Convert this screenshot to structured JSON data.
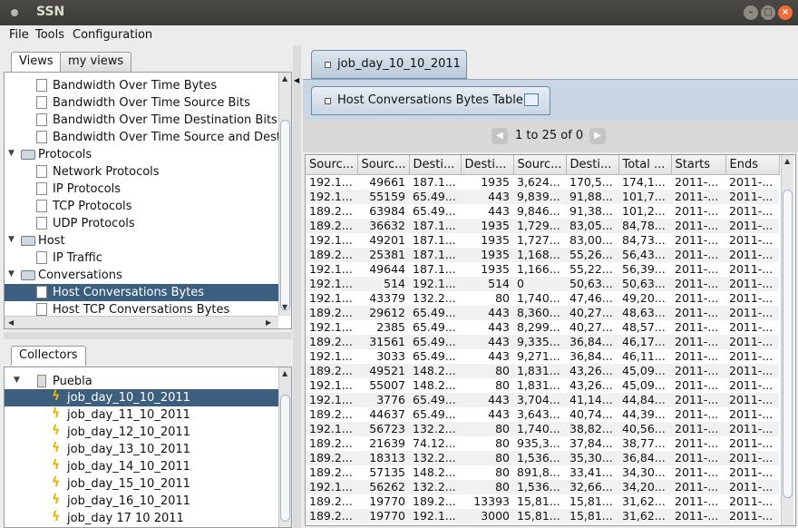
{
  "window": {
    "title": "SSN"
  },
  "menu": [
    "File",
    "Tools",
    "Configuration"
  ],
  "views_panel": {
    "tabs": [
      "Views",
      "my views"
    ],
    "items": [
      {
        "label": "Bandwidth Over Time Bytes",
        "type": "doc",
        "level": 2
      },
      {
        "label": "Bandwidth Over Time Source Bits",
        "type": "doc",
        "level": 2
      },
      {
        "label": "Bandwidth Over Time Destination Bits",
        "type": "doc",
        "level": 2
      },
      {
        "label": "Bandwidth Over Time Source and Destin",
        "type": "doc",
        "level": 2
      },
      {
        "label": "Protocols",
        "type": "folder",
        "level": 1
      },
      {
        "label": "Network Protocols",
        "type": "doc",
        "level": 2
      },
      {
        "label": "IP Protocols",
        "type": "doc",
        "level": 2
      },
      {
        "label": "TCP Protocols",
        "type": "doc",
        "level": 2
      },
      {
        "label": "UDP Protocols",
        "type": "doc",
        "level": 2
      },
      {
        "label": "Host",
        "type": "folder",
        "level": 1
      },
      {
        "label": "IP Traffic",
        "type": "doc",
        "level": 2
      },
      {
        "label": "Conversations",
        "type": "folder",
        "level": 1
      },
      {
        "label": "Host Conversations Bytes",
        "type": "doc",
        "level": 2,
        "selected": true
      },
      {
        "label": "Host TCP Conversations Bytes",
        "type": "doc",
        "level": 2
      }
    ]
  },
  "collectors_panel": {
    "tab": "Collectors",
    "root": "Puebla",
    "jobs": [
      {
        "label": "job_day_10_10_2011",
        "selected": true
      },
      {
        "label": "job_day_11_10_2011"
      },
      {
        "label": "job_day_12_10_2011"
      },
      {
        "label": "job_day_13_10_2011"
      },
      {
        "label": "job_day_14_10_2011"
      },
      {
        "label": "job_day_15_10_2011"
      },
      {
        "label": "job_day_16_10_2011"
      },
      {
        "label": "job_day 17 10 2011"
      }
    ]
  },
  "right": {
    "job_tab": "job_day_10_10_2011",
    "view_tab": "Host Conversations Bytes Table",
    "pager_text": "1 to 25 of 0",
    "columns": [
      "Sourc...",
      "Sourc...",
      "Desti...",
      "Desti...",
      "Sourc...",
      "Desti...",
      "Total ...",
      "Starts",
      "Ends"
    ],
    "rows": [
      [
        "192.1...",
        "49661",
        "187.1...",
        "1935",
        "3,624...",
        "170,5...",
        "174,1...",
        "2011-...",
        "2011-..."
      ],
      [
        "192.1...",
        "55159",
        "65.49...",
        "443",
        "9,839...",
        "91,88...",
        "101,7...",
        "2011-...",
        "2011-..."
      ],
      [
        "189.2...",
        "63984",
        "65.49...",
        "443",
        "9,846...",
        "91,38...",
        "101,2...",
        "2011-...",
        "2011-..."
      ],
      [
        "189.2...",
        "36632",
        "187.1...",
        "1935",
        "1,729...",
        "83,05...",
        "84,78...",
        "2011-...",
        "2011-..."
      ],
      [
        "192.1...",
        "49201",
        "187.1...",
        "1935",
        "1,727...",
        "83,00...",
        "84,73...",
        "2011-...",
        "2011-..."
      ],
      [
        "189.2...",
        "25381",
        "187.1...",
        "1935",
        "1,168...",
        "55,26...",
        "56,43...",
        "2011-...",
        "2011-..."
      ],
      [
        "192.1...",
        "49644",
        "187.1...",
        "1935",
        "1,166...",
        "55,22...",
        "56,39...",
        "2011-...",
        "2011-..."
      ],
      [
        "192.1...",
        "514",
        "192.1...",
        "514",
        "0",
        "50,63...",
        "50,63...",
        "2011-...",
        "2011-..."
      ],
      [
        "192.1...",
        "43379",
        "132.2...",
        "80",
        "1,740...",
        "47,46...",
        "49,20...",
        "2011-...",
        "2011-..."
      ],
      [
        "189.2...",
        "29612",
        "65.49...",
        "443",
        "8,360...",
        "40,27...",
        "48,63...",
        "2011-...",
        "2011-..."
      ],
      [
        "192.1...",
        "2385",
        "65.49...",
        "443",
        "8,299...",
        "40,27...",
        "48,57...",
        "2011-...",
        "2011-..."
      ],
      [
        "189.2...",
        "31561",
        "65.49...",
        "443",
        "9,335...",
        "36,84...",
        "46,17...",
        "2011-...",
        "2011-..."
      ],
      [
        "192.1...",
        "3033",
        "65.49...",
        "443",
        "9,271...",
        "36,84...",
        "46,11...",
        "2011-...",
        "2011-..."
      ],
      [
        "189.2...",
        "49521",
        "148.2...",
        "80",
        "1,831...",
        "43,26...",
        "45,09...",
        "2011-...",
        "2011-..."
      ],
      [
        "192.1...",
        "55007",
        "148.2...",
        "80",
        "1,831...",
        "43,26...",
        "45,09...",
        "2011-...",
        "2011-..."
      ],
      [
        "192.1...",
        "3776",
        "65.49...",
        "443",
        "3,704...",
        "41,14...",
        "44,84...",
        "2011-...",
        "2011-..."
      ],
      [
        "189.2...",
        "44637",
        "65.49...",
        "443",
        "3,643...",
        "40,74...",
        "44,39...",
        "2011-...",
        "2011-..."
      ],
      [
        "192.1...",
        "56723",
        "132.2...",
        "80",
        "1,740...",
        "38,82...",
        "40,56...",
        "2011-...",
        "2011-..."
      ],
      [
        "189.2...",
        "21639",
        "74.12...",
        "80",
        "935,3...",
        "37,84...",
        "38,77...",
        "2011-...",
        "2011-..."
      ],
      [
        "189.2...",
        "18313",
        "132.2...",
        "80",
        "1,536...",
        "35,30...",
        "36,84...",
        "2011-...",
        "2011-..."
      ],
      [
        "189.2...",
        "57135",
        "148.2...",
        "80",
        "891,8...",
        "33,41...",
        "34,30...",
        "2011-...",
        "2011-..."
      ],
      [
        "192.1...",
        "56262",
        "132.2...",
        "80",
        "1,536...",
        "32,66...",
        "34,20...",
        "2011-...",
        "2011-..."
      ],
      [
        "189.2...",
        "19770",
        "189.2...",
        "13393",
        "15,81...",
        "15,81...",
        "31,62...",
        "2011-...",
        "2011-..."
      ],
      [
        "189.2...",
        "19770",
        "192.1...",
        "3000",
        "15,81...",
        "15,81...",
        "31,62...",
        "2011-...",
        "2011-..."
      ]
    ]
  },
  "colors": {
    "selection": "#3c5f7f",
    "titlebar": "#3c3b37",
    "close": "#ef6c3b"
  }
}
